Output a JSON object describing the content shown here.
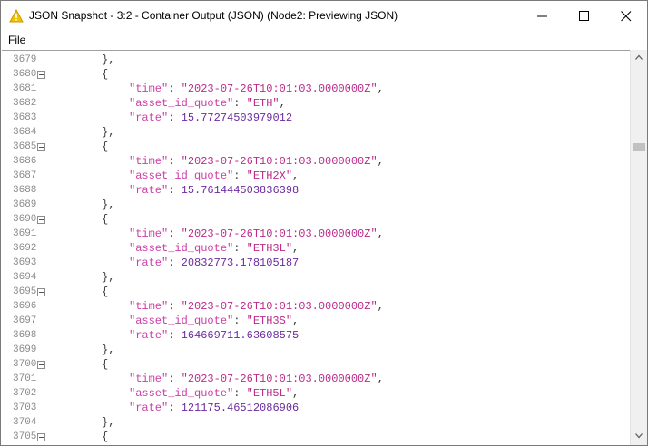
{
  "window": {
    "title": "JSON Snapshot - 3:2 - Container Output (JSON) (Node2: Previewing JSON)",
    "icon": "warning-icon",
    "accent_color": "#f2c200"
  },
  "menu": {
    "file_label": "File"
  },
  "editor": {
    "lines": [
      {
        "num": "3679",
        "fold": false,
        "type": "close"
      },
      {
        "num": "3680",
        "fold": true,
        "type": "open"
      },
      {
        "num": "3681",
        "fold": false,
        "type": "kv",
        "key": "\"time\"",
        "value": "\"2023-07-26T10:01:03.0000000Z\"",
        "vtype": "str",
        "comma": ","
      },
      {
        "num": "3682",
        "fold": false,
        "type": "kv",
        "key": "\"asset_id_quote\"",
        "value": "\"ETH\"",
        "vtype": "str",
        "comma": ","
      },
      {
        "num": "3683",
        "fold": false,
        "type": "kv",
        "key": "\"rate\"",
        "value": "15.77274503979012",
        "vtype": "num",
        "comma": ""
      },
      {
        "num": "3684",
        "fold": false,
        "type": "close"
      },
      {
        "num": "3685",
        "fold": true,
        "type": "open"
      },
      {
        "num": "3686",
        "fold": false,
        "type": "kv",
        "key": "\"time\"",
        "value": "\"2023-07-26T10:01:03.0000000Z\"",
        "vtype": "str",
        "comma": ","
      },
      {
        "num": "3687",
        "fold": false,
        "type": "kv",
        "key": "\"asset_id_quote\"",
        "value": "\"ETH2X\"",
        "vtype": "str",
        "comma": ","
      },
      {
        "num": "3688",
        "fold": false,
        "type": "kv",
        "key": "\"rate\"",
        "value": "15.761444503836398",
        "vtype": "num",
        "comma": ""
      },
      {
        "num": "3689",
        "fold": false,
        "type": "close"
      },
      {
        "num": "3690",
        "fold": true,
        "type": "open"
      },
      {
        "num": "3691",
        "fold": false,
        "type": "kv",
        "key": "\"time\"",
        "value": "\"2023-07-26T10:01:03.0000000Z\"",
        "vtype": "str",
        "comma": ","
      },
      {
        "num": "3692",
        "fold": false,
        "type": "kv",
        "key": "\"asset_id_quote\"",
        "value": "\"ETH3L\"",
        "vtype": "str",
        "comma": ","
      },
      {
        "num": "3693",
        "fold": false,
        "type": "kv",
        "key": "\"rate\"",
        "value": "20832773.178105187",
        "vtype": "num",
        "comma": ""
      },
      {
        "num": "3694",
        "fold": false,
        "type": "close"
      },
      {
        "num": "3695",
        "fold": true,
        "type": "open"
      },
      {
        "num": "3696",
        "fold": false,
        "type": "kv",
        "key": "\"time\"",
        "value": "\"2023-07-26T10:01:03.0000000Z\"",
        "vtype": "str",
        "comma": ","
      },
      {
        "num": "3697",
        "fold": false,
        "type": "kv",
        "key": "\"asset_id_quote\"",
        "value": "\"ETH3S\"",
        "vtype": "str",
        "comma": ","
      },
      {
        "num": "3698",
        "fold": false,
        "type": "kv",
        "key": "\"rate\"",
        "value": "164669711.63608575",
        "vtype": "num",
        "comma": ""
      },
      {
        "num": "3699",
        "fold": false,
        "type": "close"
      },
      {
        "num": "3700",
        "fold": true,
        "type": "open"
      },
      {
        "num": "3701",
        "fold": false,
        "type": "kv",
        "key": "\"time\"",
        "value": "\"2023-07-26T10:01:03.0000000Z\"",
        "vtype": "str",
        "comma": ","
      },
      {
        "num": "3702",
        "fold": false,
        "type": "kv",
        "key": "\"asset_id_quote\"",
        "value": "\"ETH5L\"",
        "vtype": "str",
        "comma": ","
      },
      {
        "num": "3703",
        "fold": false,
        "type": "kv",
        "key": "\"rate\"",
        "value": "121175.46512086906",
        "vtype": "num",
        "comma": ""
      },
      {
        "num": "3704",
        "fold": false,
        "type": "close"
      },
      {
        "num": "3705",
        "fold": true,
        "type": "open"
      }
    ]
  },
  "scrollbar": {
    "position_fraction": 0.22
  }
}
